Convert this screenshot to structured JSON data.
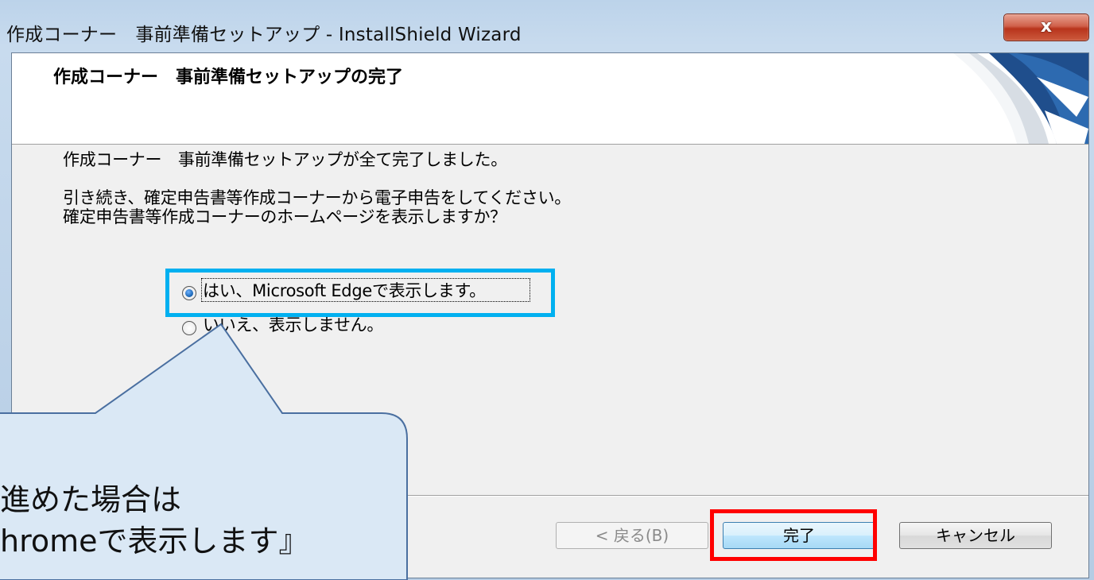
{
  "window": {
    "title": "作成コーナー　事前準備セットアップ - InstallShield Wizard",
    "close_label": "x"
  },
  "header": {
    "title": "作成コーナー　事前準備セットアップの完了"
  },
  "body": {
    "line1": "作成コーナー　事前準備セットアップが全て完了しました。",
    "line2": "引き続き、確定申告書等作成コーナーから電子申告をしてください。",
    "line3": "確定申告書等作成コーナーのホームページを表示しますか？"
  },
  "options": {
    "yes_label": "はい、Microsoft Edgeで表示します。",
    "no_label": "いいえ、表示しません。",
    "selected": "yes"
  },
  "buttons": {
    "back": "< 戻る(B)",
    "finish": "完了",
    "cancel": "キャンセル"
  },
  "callout": {
    "line1": "進めた場合は",
    "line2": "hromeで表示します』"
  },
  "colors": {
    "highlight_blue": "#00b0f0",
    "highlight_red": "#ff0000",
    "callout_fill": "#dae8f5",
    "callout_border": "#4a6fa0"
  }
}
